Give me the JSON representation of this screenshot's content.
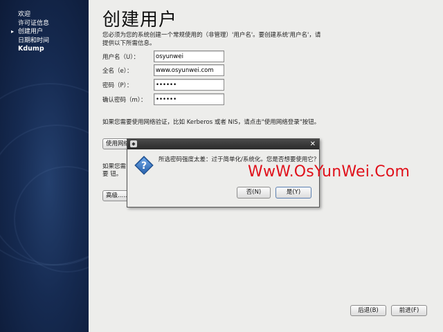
{
  "sidebar": {
    "items": [
      {
        "label": "欢迎",
        "current": false
      },
      {
        "label": "许可证信息",
        "current": false
      },
      {
        "label": "创建用户",
        "current": true
      },
      {
        "label": "日期和时间",
        "current": false
      },
      {
        "label": "Kdump",
        "current": false
      }
    ],
    "current_marker": "▸"
  },
  "page": {
    "title": "创建用户",
    "description": "您必须为您的系统创建一个常规使用的（非管理）'用户名'。要创建系统'用户名'，请提供以下所需信息。"
  },
  "form": {
    "username": {
      "label": "用户名（U）：",
      "value": "osyunwei"
    },
    "fullname": {
      "label": "全名（e）：",
      "value": "www.osyunwei.com"
    },
    "password": {
      "label": "密码（P）：",
      "value": "••••••"
    },
    "confirm": {
      "label": "确认密码（m）：",
      "value": "••••••"
    }
  },
  "network": {
    "text": "如果您需要使用网络验证，比如 Kerberos 或者 NIS，请点击\"使用网络登录\"按钮。",
    "button_label": "使用网络",
    "kerb_text": "如果您需要 钮。",
    "advanced_label": "高级......"
  },
  "dialog": {
    "message": "所选密码强度太差：过于简单化/系统化。您是否想要使用它？",
    "no_label": "否(N)",
    "yes_label": "是(Y)",
    "close_glyph": "✕",
    "icon": "question-icon"
  },
  "nav": {
    "back_label": "后退(B)",
    "forward_label": "前进(F)"
  },
  "watermark": "WwW.OsYunWei.Com",
  "colors": {
    "sidebar_bg": "#162b52",
    "watermark": "#e0101a",
    "dialog_icon": "#2f6db8"
  }
}
